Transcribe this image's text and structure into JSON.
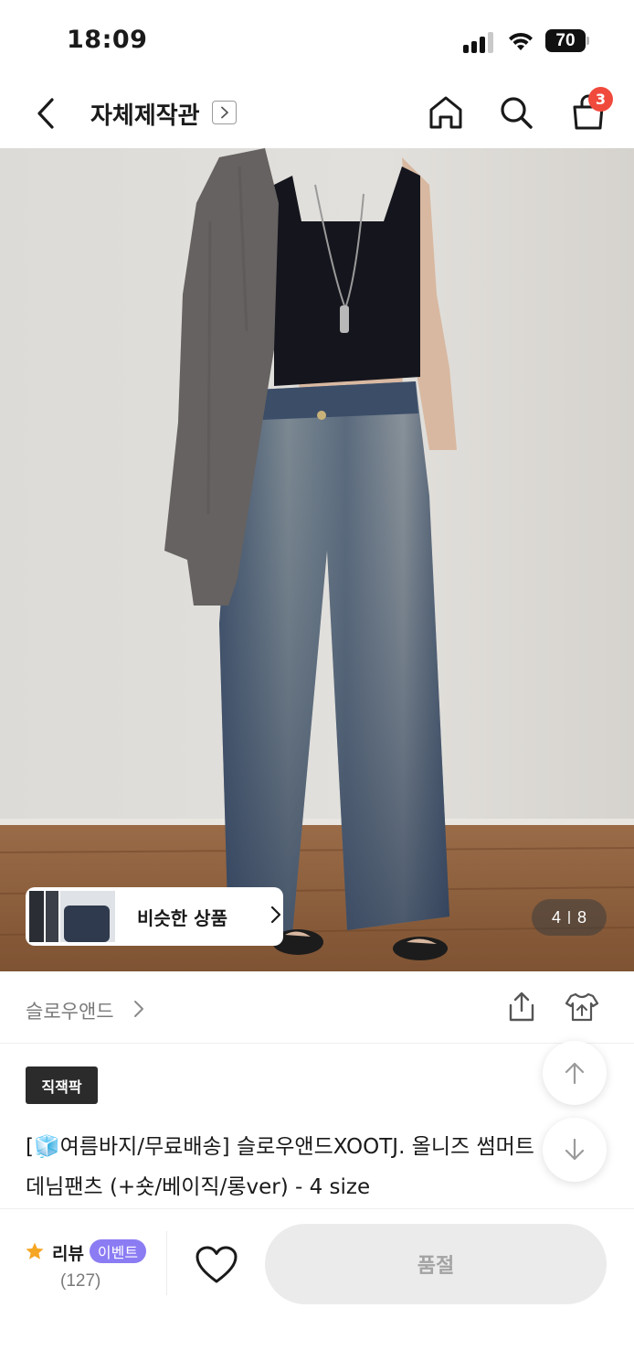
{
  "status_bar": {
    "time": "18:09",
    "battery": "70",
    "icons": [
      "signal-icon",
      "wifi-icon",
      "battery-icon"
    ]
  },
  "nav": {
    "title": "자체제작관",
    "cart_count": "3",
    "icons": [
      "back-icon",
      "chevron-right-icon",
      "home-icon",
      "search-icon",
      "shopping-bag-icon"
    ]
  },
  "hero": {
    "similar_label": "비슷한 상품",
    "page_current": "4",
    "page_total": "8"
  },
  "brand": {
    "name": "슬로우앤드",
    "icons": [
      "share-icon",
      "fitting-icon"
    ]
  },
  "product": {
    "tag": "직잭팍",
    "title_prefix": "[",
    "title_emoji": "🧊",
    "title_rest": "여름바지/무료배송] 슬로우앤드XOOTJ. 올니즈 썸머트 데님팬츠 (+숏/베이직/롱ver) - 4 size"
  },
  "bottom": {
    "review_label": "리뷰",
    "event_label": "이벤트",
    "review_count": "(127)",
    "soldout_label": "품절"
  },
  "colors": {
    "accent_badge": "#f04a3c",
    "event_badge": "#8b7cf3",
    "star": "#f5a623",
    "soldout_bg": "#ebebeb"
  }
}
